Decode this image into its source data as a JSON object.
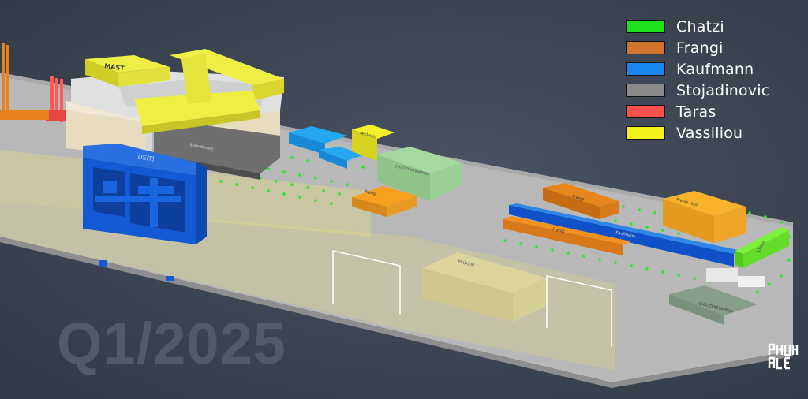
{
  "legend": {
    "items": [
      {
        "name": "Chatzi",
        "color": "#1ee11e"
      },
      {
        "name": "Frangi",
        "color": "#d0742e"
      },
      {
        "name": "Kaufmann",
        "color": "#1a86f0"
      },
      {
        "name": "Stojadinovic",
        "color": "#8a8a8a"
      },
      {
        "name": "Taras",
        "color": "#ff5050"
      },
      {
        "name": "Vassiliou",
        "color": "#f2f218"
      }
    ]
  },
  "overlay": {
    "quarter": "Q1/2025"
  },
  "scene_labels": {
    "mast": "MAST",
    "lusit": "LUSIT",
    "prufkem": "PRÜKEM",
    "chatzi_kemapod": "CHATZI KEMAPOD",
    "chatzi_kemapod_lower": "CHATZI KEMAPOD",
    "michalis": "Michalis",
    "chatzi_block": "Chatzi",
    "frangi_top": "Frangi",
    "frangi_bottom": "Frangi",
    "frangi_right": "Frangi Holz"
  },
  "colors": {
    "background": "#3c4452",
    "floor": "#b9b9b9",
    "floor_edge": "#8c8c8c",
    "dot": "#2be82b"
  }
}
